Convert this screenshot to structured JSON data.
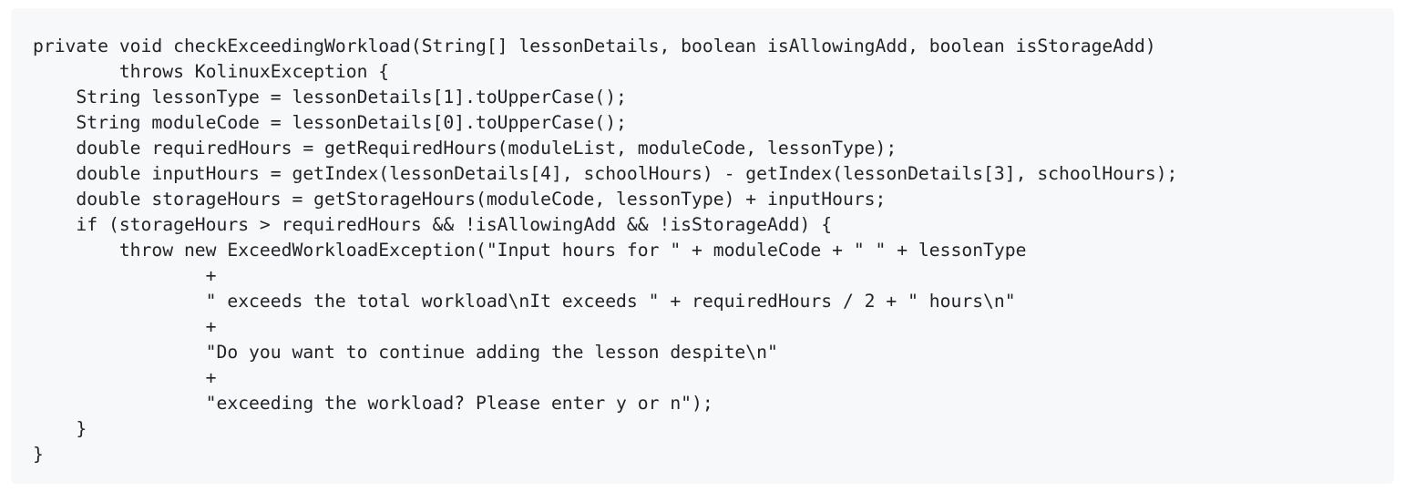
{
  "code": {
    "lines": [
      "private void checkExceedingWorkload(String[] lessonDetails, boolean isAllowingAdd, boolean isStorageAdd)",
      "        throws KolinuxException {",
      "    String lessonType = lessonDetails[1].toUpperCase();",
      "    String moduleCode = lessonDetails[0].toUpperCase();",
      "    double requiredHours = getRequiredHours(moduleList, moduleCode, lessonType);",
      "    double inputHours = getIndex(lessonDetails[4], schoolHours) - getIndex(lessonDetails[3], schoolHours);",
      "    double storageHours = getStorageHours(moduleCode, lessonType) + inputHours;",
      "    if (storageHours > requiredHours && !isAllowingAdd && !isStorageAdd) {",
      "        throw new ExceedWorkloadException(\"Input hours for \" + moduleCode + \" \" + lessonType",
      "                +",
      "                \" exceeds the total workload\\nIt exceeds \" + requiredHours / 2 + \" hours\\n\"",
      "                +",
      "                \"Do you want to continue adding the lesson despite\\n\"",
      "                +",
      "                \"exceeding the workload? Please enter y or n\");",
      "    }",
      "}"
    ]
  }
}
